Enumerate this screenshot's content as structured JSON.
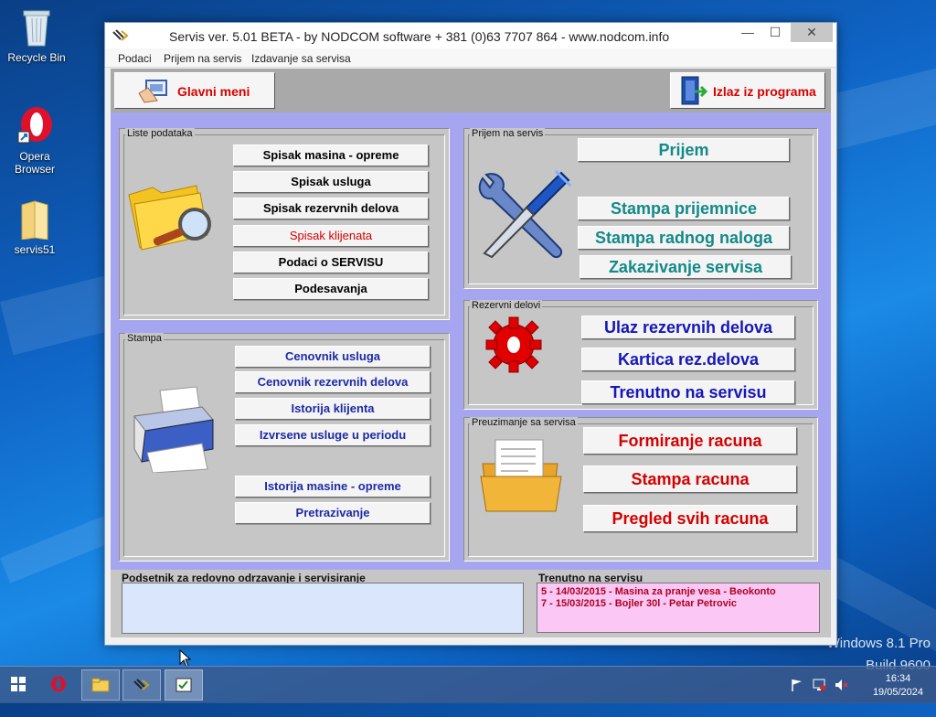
{
  "desktop": {
    "icons": [
      {
        "label": "Recycle Bin"
      },
      {
        "label": "Opera Browser"
      },
      {
        "label": "servis51"
      }
    ],
    "watermark": {
      "line1": "Windows 8.1 Pro",
      "line2": "Build 9600"
    }
  },
  "window": {
    "title": "Servis ver. 5.01 BETA - by NODCOM software  + 381 (0)63 7707 864 - www.nodcom.info",
    "controls": {
      "minimize": "—",
      "maximize": "☐",
      "close": "✕"
    },
    "menu": [
      "Podaci",
      "Prijem na servis",
      "Izdavanje sa servisa"
    ],
    "toolbar": {
      "main_menu": "Glavni meni",
      "exit": "Izlaz iz programa"
    }
  },
  "panels": {
    "lists": {
      "title": "Liste podataka",
      "buttons": [
        "Spisak masina - opreme",
        "Spisak usluga",
        "Spisak rezervnih delova",
        "Spisak klijenata",
        "Podaci o SERVISU",
        "Podesavanja"
      ]
    },
    "print": {
      "title": "Stampa",
      "buttons": [
        "Cenovnik usluga",
        "Cenovnik rezervnih delova",
        "Istorija klijenta",
        "Izvrsene usluge u periodu",
        "Istorija masine - opreme",
        "Pretrazivanje"
      ]
    },
    "intake": {
      "title": "Prijem na servis",
      "buttons": [
        "Prijem",
        "Stampa prijemnice",
        "Stampa radnog naloga",
        "Zakazivanje servisa"
      ]
    },
    "parts": {
      "title": "Rezervni delovi",
      "buttons": [
        "Ulaz rezervnih delova",
        "Kartica rez.delova",
        "Trenutno na servisu"
      ]
    },
    "pickup": {
      "title": "Preuzimanje sa servisa",
      "buttons": [
        "Formiranje racuna",
        "Stampa racuna",
        "Pregled svih racuna"
      ]
    }
  },
  "reminder": {
    "label": "Podsetnik za redovno odrzavanje i servisiranje"
  },
  "current": {
    "label": "Trenutno na servisu",
    "items": [
      "5 - 14/03/2015 - Masina za pranje vesa - Beokonto",
      "7 - 15/03/2015 - Bojler 30l - Petar Petrovic"
    ]
  },
  "taskbar": {
    "time": "16:34",
    "date": "19/05/2024"
  },
  "colors": {
    "accent_red": "#d60000",
    "teal": "#138a88",
    "navy": "#1517b8",
    "panel_bg": "#a6a6f0"
  }
}
